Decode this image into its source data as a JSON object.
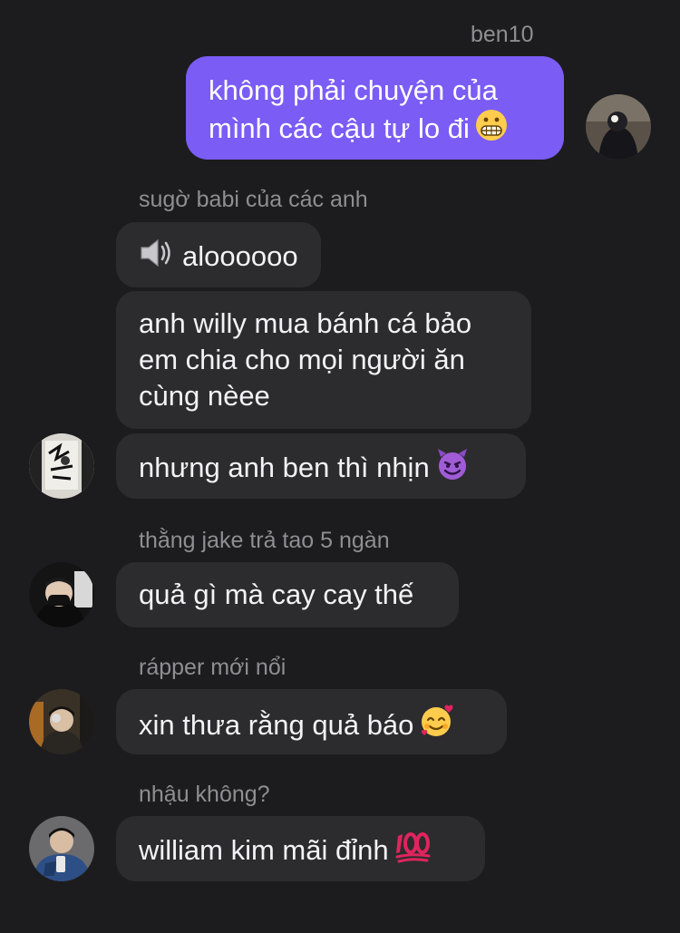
{
  "conversation": {
    "outgoing": {
      "sender": "ben10",
      "lines": [
        "không phải chuyện của",
        "mình các cậu tự lo đi"
      ],
      "emoji": "grimacing-face-icon"
    },
    "groups": [
      {
        "sender": "sugờ babi của các anh",
        "messages": [
          {
            "text": "aloooooo",
            "icon": "speaker-icon"
          },
          {
            "lines": [
              "anh willy mua bánh cá bảo",
              "em chia cho mọi người ăn",
              "cùng nèee"
            ]
          },
          {
            "text": "nhưng anh ben thì nhịn",
            "emoji": "smiling-devil-icon"
          }
        ]
      },
      {
        "sender": "thằng jake trả tao 5 ngàn",
        "messages": [
          {
            "text": "quả gì mà cay cay thế"
          }
        ]
      },
      {
        "sender": "rápper mới nổi",
        "messages": [
          {
            "text": "xin thưa rằng quả báo",
            "emoji": "smiling-face-with-hearts-icon"
          }
        ]
      },
      {
        "sender": "nhậu không?",
        "messages": [
          {
            "text": "william kim mãi đỉnh",
            "emoji": "hundred-points-icon"
          }
        ]
      }
    ]
  },
  "colors": {
    "background": "#1c1c1e",
    "incoming_bubble": "#2c2c2e",
    "outgoing_bubble": "#7b5cf5",
    "sender_label": "#8e8e93",
    "text": "#f2f2f7"
  }
}
